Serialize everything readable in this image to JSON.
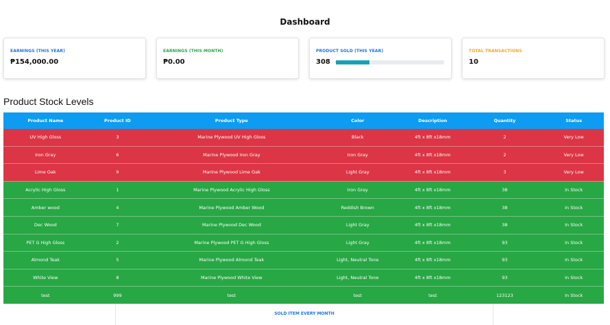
{
  "header": {
    "title": "Dashboard"
  },
  "cards": [
    {
      "label": "EARNINGS (THIS YEAR)",
      "value": "₱154,000.00",
      "color": "#1a73e8"
    },
    {
      "label": "EARNINGS (THIS MONTH)",
      "value": "₱0.00",
      "color": "#28a745"
    },
    {
      "label": "PRODUCT SOLD (THIS YEAR)",
      "value": "308",
      "color": "#1a73e8",
      "progress": 0.31
    },
    {
      "label": "TOTAL TRANSACTIONS",
      "value": "10",
      "color": "#f5a623"
    }
  ],
  "stock": {
    "title": "Product Stock Levels",
    "columns": [
      "Product Name",
      "Product ID",
      "Product Type",
      "Color",
      "Description",
      "Quantity",
      "Status"
    ],
    "colors": {
      "header": "#0d9cf1",
      "very_low": "#dc3545",
      "in_stock": "#28a745"
    },
    "rows": [
      {
        "cells": [
          "UV High Gloss",
          "3",
          "Marine Plywood UV High Gloss",
          "Black",
          "4ft x 8ft x18mm",
          "2",
          "Very Low"
        ],
        "level": "very_low"
      },
      {
        "cells": [
          "Iron Gray",
          "6",
          "Marine Plywood Iron Gray",
          "Iron Gray",
          "4ft x 8ft x18mm",
          "2",
          "Very Low"
        ],
        "level": "very_low"
      },
      {
        "cells": [
          "Lime Oak",
          "9",
          "Marine Plywood Lime Oak",
          "Light Gray",
          "4ft x 8ft x18mm",
          "3",
          "Very Low"
        ],
        "level": "very_low"
      },
      {
        "cells": [
          "Acrylic High Gloss",
          "1",
          "Marine Plywood Acrylic High Gloss",
          "Iron Gray",
          "4ft x 8ft x18mm",
          "38",
          "In Stock"
        ],
        "level": "in_stock"
      },
      {
        "cells": [
          "Amber wood",
          "4",
          "Marine Plywood Amber Wood",
          "Reddish Brown",
          "4ft x 8ft x18mm",
          "38",
          "In Stock"
        ],
        "level": "in_stock"
      },
      {
        "cells": [
          "Dec Wood",
          "7",
          "Marine Plywood Dec Wood",
          "Light Gray",
          "4ft x 8ft x18mm",
          "38",
          "In Stock"
        ],
        "level": "in_stock"
      },
      {
        "cells": [
          "PET G High Gloss",
          "2",
          "Marine Plywood PET G High Gloss",
          "Light Gray",
          "4ft x 8ft x18mm",
          "93",
          "In Stock"
        ],
        "level": "in_stock"
      },
      {
        "cells": [
          "Almond Teak",
          "5",
          "Marine Plywood Almond Teak",
          "Light, Neutral Tone",
          "4ft x 8ft x18mm",
          "93",
          "In Stock"
        ],
        "level": "in_stock"
      },
      {
        "cells": [
          "White View",
          "8",
          "Marine Plywood White View",
          "Light, Neutral Tone",
          "4ft x 8ft x18mm",
          "93",
          "In Stock"
        ],
        "level": "in_stock"
      },
      {
        "cells": [
          "test",
          "999",
          "test",
          "test",
          "test",
          "123123",
          "In Stock"
        ],
        "level": "in_stock"
      }
    ]
  },
  "bottom": {
    "label": "SOLD ITEM EVERY MONTH"
  }
}
